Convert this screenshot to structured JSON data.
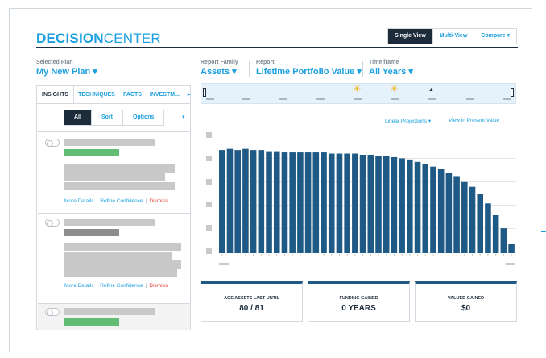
{
  "brand": {
    "bold": "DECISION",
    "light": "CENTER"
  },
  "views": [
    "Single View",
    "Multi-View",
    "Compare ▾"
  ],
  "selected_plan": {
    "label": "Selected Plan",
    "value": "My New Plan ▾"
  },
  "report_family": {
    "label": "Report Family",
    "value": "Assets ▾"
  },
  "report": {
    "label": "Report",
    "value": "Lifetime Portfolio Value ▾"
  },
  "time_frame": {
    "label": "Time frame",
    "value": "All Years ▾"
  },
  "tabs": [
    "INSIGHTS",
    "TECHNIQUES",
    "FACTS",
    "INVESTM...",
    "▸"
  ],
  "filters": [
    "All",
    "Sort",
    "Options"
  ],
  "filter_caret": "▾",
  "card_links": {
    "details": "More Details",
    "refine": "Refine Confidence",
    "dismiss": "Dismiss",
    "sep": "|"
  },
  "projection_links": {
    "linear": "Linear Projections ▾",
    "present": "View in Present Value"
  },
  "timeline_icons": {
    "sun": "☀",
    "marker": "▲"
  },
  "chart_data": {
    "type": "bar",
    "title": "",
    "xlabel": "",
    "ylabel": "",
    "color": "#1f5a86",
    "values": [
      87,
      88,
      87,
      88,
      87,
      87,
      86,
      86,
      85,
      85,
      85,
      85,
      85,
      85,
      84,
      84,
      84,
      84,
      83,
      83,
      82,
      82,
      81,
      80,
      79,
      77,
      75,
      73,
      71,
      68,
      65,
      60,
      56,
      50,
      42,
      32,
      21,
      8
    ],
    "ylim": [
      0,
      100
    ],
    "grid": true
  },
  "stats": [
    {
      "label": "AGE ASSETS LAST UNTIL",
      "value": "80 / 81"
    },
    {
      "label": "FUNDING GAINED",
      "value": "0 YEARS"
    },
    {
      "label": "VALUED GAINED",
      "value": "$0"
    }
  ],
  "colors": {
    "accent": "#1a9fe0",
    "dark": "#1d2c3b",
    "bar": "#1f5a86",
    "green": "#62bd74",
    "danger": "#e0433b"
  }
}
